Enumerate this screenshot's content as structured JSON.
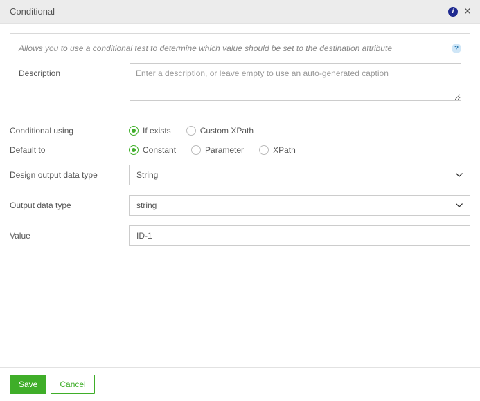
{
  "header": {
    "title": "Conditional"
  },
  "panel": {
    "help_text": "Allows you to use a conditional test to determine which value should be set to the destination attribute",
    "description_label": "Description",
    "description_value": "",
    "description_placeholder": "Enter a description, or leave empty to use an auto-generated caption"
  },
  "form": {
    "conditional_using": {
      "label": "Conditional using",
      "options": [
        {
          "label": "If exists",
          "selected": true
        },
        {
          "label": "Custom XPath",
          "selected": false
        }
      ]
    },
    "default_to": {
      "label": "Default to",
      "options": [
        {
          "label": "Constant",
          "selected": true
        },
        {
          "label": "Parameter",
          "selected": false
        },
        {
          "label": "XPath",
          "selected": false
        }
      ]
    },
    "design_output_data_type": {
      "label": "Design output data type",
      "value": "String"
    },
    "output_data_type": {
      "label": "Output data type",
      "value": "string"
    },
    "value": {
      "label": "Value",
      "value": "ID-1"
    }
  },
  "footer": {
    "save_label": "Save",
    "cancel_label": "Cancel"
  },
  "colors": {
    "accent_green": "#3fae29",
    "info_blue": "#1f2a90"
  }
}
